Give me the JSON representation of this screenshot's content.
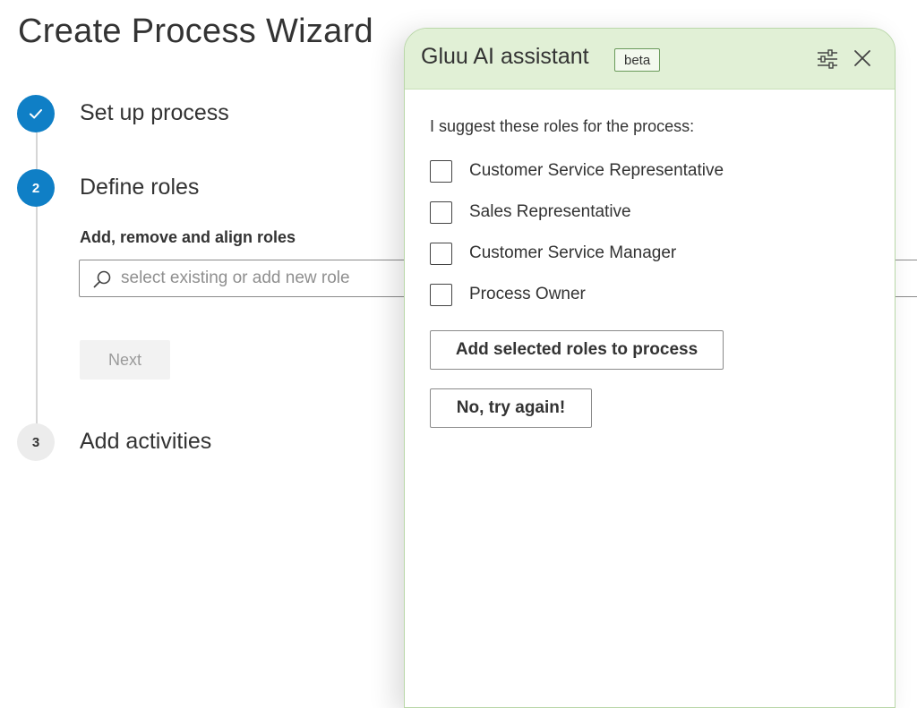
{
  "wizard": {
    "title": "Create Process Wizard",
    "steps": [
      {
        "number": "",
        "label": "Set up process",
        "state": "done"
      },
      {
        "number": "2",
        "label": "Define roles",
        "state": "active"
      },
      {
        "number": "3",
        "label": "Add activities",
        "state": "todo"
      }
    ],
    "roles_section_label": "Add, remove and align roles",
    "role_search": {
      "placeholder": "select existing or add new role",
      "value": ""
    },
    "next_label": "Next"
  },
  "assistant": {
    "title": "Gluu AI assistant",
    "badge": "beta",
    "prompt": "I suggest these roles for the process:",
    "roles": [
      {
        "label": "Customer Service Representative",
        "checked": false
      },
      {
        "label": "Sales Representative",
        "checked": false
      },
      {
        "label": "Customer Service Manager",
        "checked": false
      },
      {
        "label": "Process Owner",
        "checked": false
      }
    ],
    "add_button_label": "Add selected roles to process",
    "retry_button_label": "No, try again!"
  },
  "icons": {
    "step_done": "checkmark-icon",
    "search": "search-icon",
    "settings": "sliders-icon",
    "close": "close-icon"
  },
  "colors": {
    "accent": "#0f7fc6",
    "assistant_header": "#e1f0d6",
    "assistant_border": "#b9d7a8",
    "disabled_button": "#f2f2f2"
  }
}
